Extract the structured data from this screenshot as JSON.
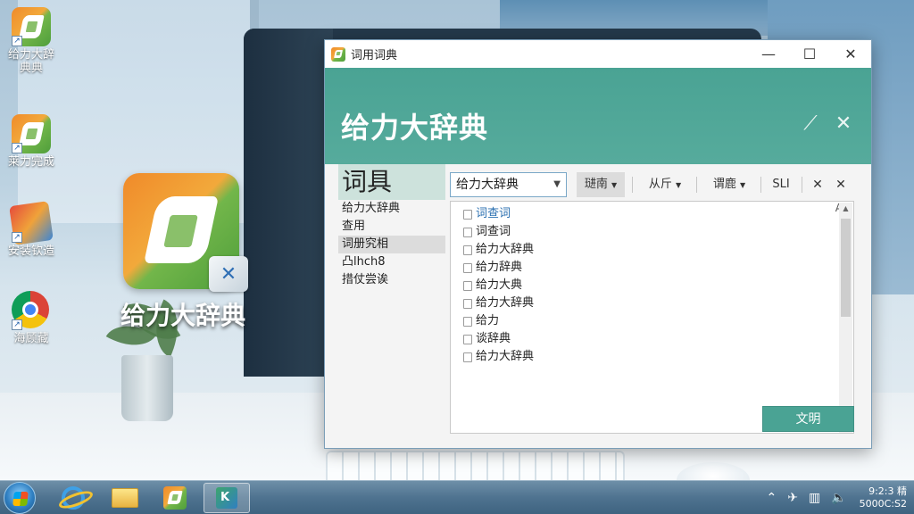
{
  "desktop": {
    "icons": [
      {
        "label": "给力大辞\n典典",
        "icon": "dictionary-app-icon"
      },
      {
        "label": "莱力完成",
        "icon": "dictionary-app-icon"
      },
      {
        "label": "安装钦造",
        "icon": "photo-app-icon"
      },
      {
        "label": "海顾藏",
        "icon": "chrome-icon"
      }
    ],
    "featured_label": "给力大辞典"
  },
  "dialog": {
    "window_title": "词用词典",
    "banner_title": "给力大辞典",
    "sidebar": {
      "header": "词具",
      "items": [
        "给力大辞典",
        "查用",
        "词册究相",
        "凸lhch8",
        "措仗尝诶"
      ],
      "active_index": 2
    },
    "toolbar": {
      "combo_value": "给力大辞典",
      "buttons": [
        "琎南",
        "从斤",
        "谓鹿",
        "SLI"
      ]
    },
    "list": {
      "header_letter": "A",
      "rows": [
        "词查词",
        "词查词",
        "给力大辞典",
        "给力辞典",
        "给力大典",
        "给力大辞典",
        "给力",
        "谈辞典",
        "给力大辞典"
      ],
      "selected_index": 0
    },
    "primary_button": "文明"
  },
  "taskbar": {
    "clock_time": "9:2:3 精",
    "clock_date": "5000C:S2"
  },
  "colors": {
    "accent": "#4aa394",
    "sidebar_header_bg": "#cde2dc",
    "selected_text": "#2a6fb0",
    "taskbar": "#4f7390"
  }
}
